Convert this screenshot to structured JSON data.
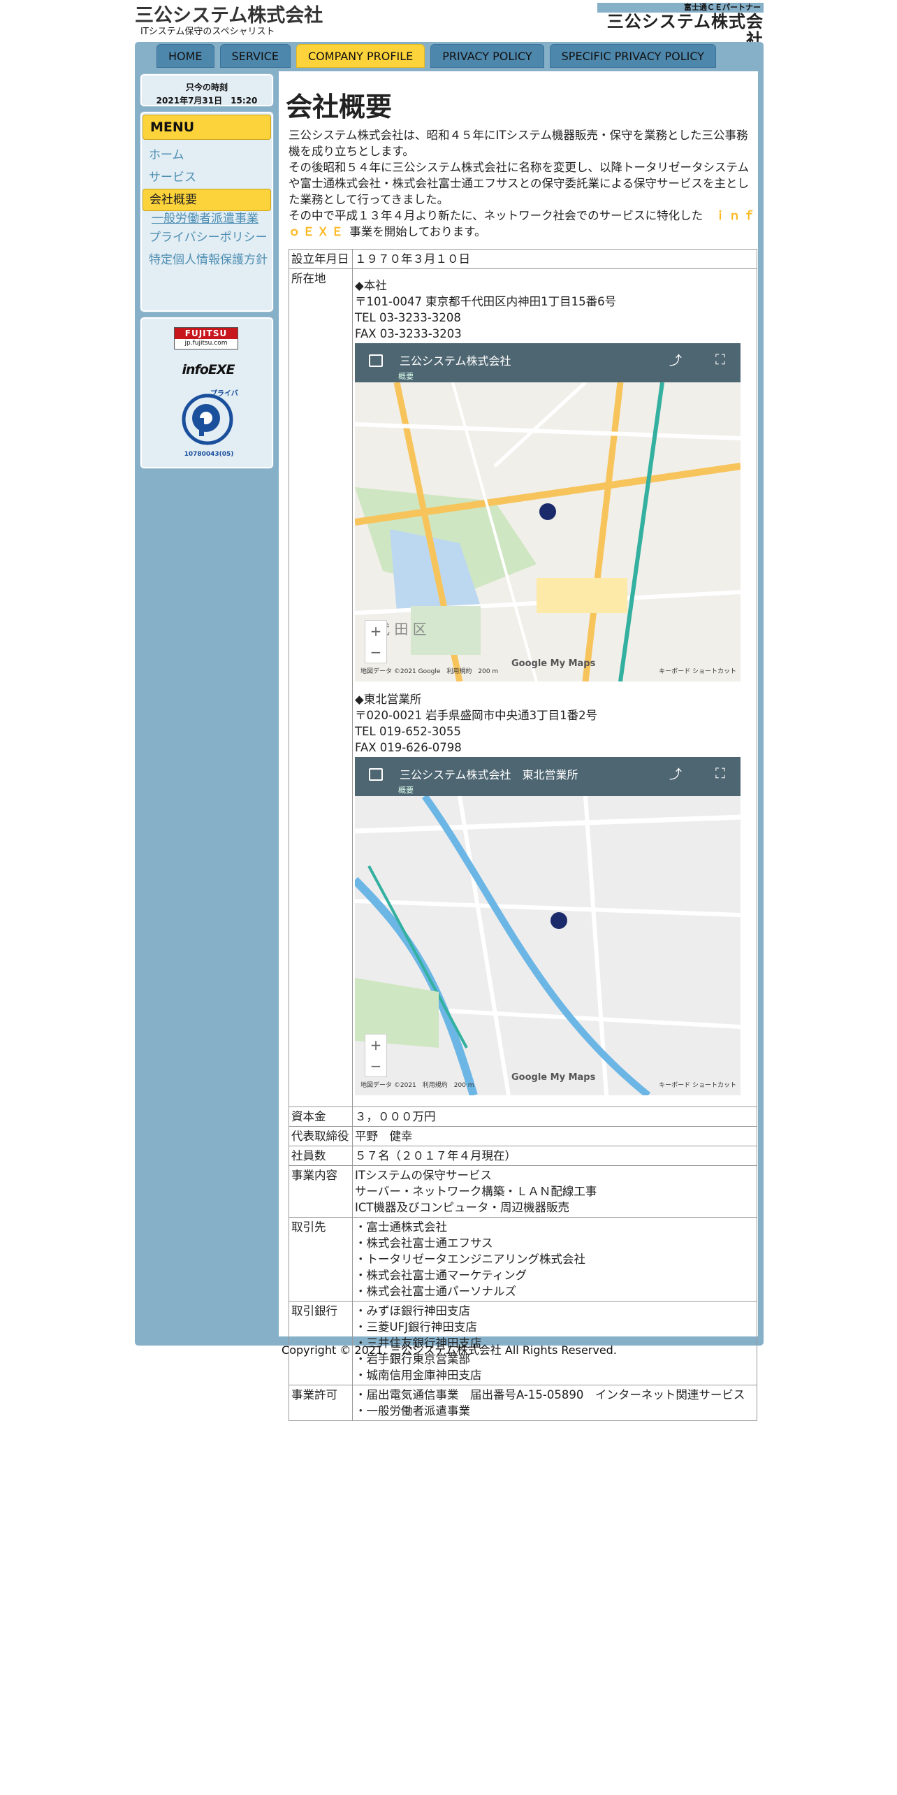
{
  "header": {
    "site_title": "三公システム株式会社",
    "site_subtitle": "ITシステム保守のスペシャリスト",
    "partner_badge": "富士通ＣＥパートナー",
    "partner_name": "三公システム株式会社"
  },
  "nav": {
    "tabs": [
      {
        "label": "HOME"
      },
      {
        "label": "SERVICE"
      },
      {
        "label": "COMPANY PROFILE",
        "active": true
      },
      {
        "label": "PRIVACY POLICY"
      },
      {
        "label": "SPECIFIC PRIVACY POLICY"
      }
    ]
  },
  "clock": {
    "label": "只今の時刻",
    "value": "2021年7月31日　15:20"
  },
  "menu": {
    "title": "MENU",
    "items": [
      {
        "label": "ホーム"
      },
      {
        "label": "サービス"
      },
      {
        "label": "会社概要",
        "current": true
      },
      {
        "label": "一般労働者派遣事業",
        "sub": true
      },
      {
        "label": "プライバシーポリシー"
      },
      {
        "label": "特定個人情報保護方針"
      }
    ]
  },
  "logos": {
    "fujitsu_name": "FUJITSU",
    "fujitsu_url": "jp.fujitsu.com",
    "infoexe": "infoEXE",
    "pmark_text": "プライバシー",
    "pmark_number": "10780043(05)"
  },
  "content": {
    "title": "会社概要",
    "intro": [
      "三公システム株式会社は、昭和４５年にITシステム機器販売・保守を業務とした三公事務機を成り立ちとします。",
      "その後昭和５４年に三公システム株式会社に名称を変更し、以降トータリゼータシステムや富士通株式会社・株式会社富士通エフサスとの保守委託業による保守サービスを主とした業務として行ってきました。"
    ],
    "intro_last_before": "その中で平成１３年４月より新たに、ネットワーク社会でのサービスに特化した　",
    "intro_brand": "ｉｎｆｏＥＸＥ",
    "intro_last_after": " 事業を開始しております。"
  },
  "table": {
    "established_label": "設立年月日",
    "established_value": "１９７０年３月１０日",
    "location_label": "所在地",
    "head_office": {
      "heading": "◆本社",
      "address": "〒101-0047 東京都千代田区内神田1丁目15番6号",
      "tel": "TEL 03-3233-3208",
      "fax": "FAX 03-3233-3203",
      "map_title": "三公システム株式会社",
      "map_sub": "概要"
    },
    "tohoku_office": {
      "heading": "◆東北営業所",
      "address": "〒020-0021 岩手県盛岡市中央通3丁目1番2号",
      "tel": "TEL 019-652-3055",
      "fax": "FAX 019-626-0798",
      "map_title": "三公システム株式会社　東北営業所",
      "map_sub": "概要"
    },
    "map_footer": "地図データ ©2021 Google　利用規約　200 m",
    "map_footer2": "地図データ ©2021　利用規約　200 m",
    "map_shortcut": "キーボード ショートカット",
    "map_google": "Google My Maps",
    "capital_label": "資本金",
    "capital_value": "３，０００万円",
    "ceo_label": "代表取締役",
    "ceo_value": "平野　健幸",
    "employees_label": "社員数",
    "employees_value": "５７名（２０１７年４月現在）",
    "business_label": "事業内容",
    "business_values": [
      "ITシステムの保守サービス",
      "サーバー・ネットワーク構築・ＬＡＮ配線工事",
      "ICT機器及びコンピュータ・周辺機器販売"
    ],
    "clients_label": "取引先",
    "clients_values": [
      "・富士通株式会社",
      "・株式会社富士通エフサス",
      "・トータリゼータエンジニアリング株式会社",
      "・株式会社富士通マーケティング",
      "・株式会社富士通パーソナルズ"
    ],
    "banks_label": "取引銀行",
    "banks_values": [
      "・みずほ銀行神田支店",
      "・三菱UFJ銀行神田支店",
      "・三井住友銀行神田支店",
      "・岩手銀行東京営業部",
      "・城南信用金庫神田支店"
    ],
    "license_label": "事業許可",
    "license_values": [
      "・届出電気通信事業　届出番号A-15-05890　インターネット関連サービス",
      "・一般労働者派遣事業"
    ]
  },
  "footer": {
    "copyright": "Copyright © 2021. 三公システム株式会社 All Rights Reserved."
  }
}
